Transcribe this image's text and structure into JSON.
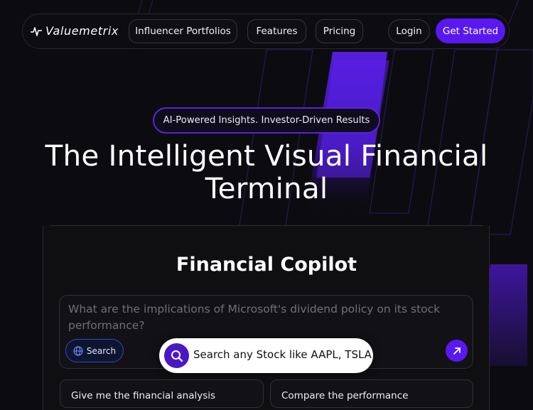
{
  "nav": {
    "brand": "Valuemetrix",
    "links": [
      "Influencer Portfolios",
      "Features",
      "Pricing"
    ],
    "login": "Login",
    "cta": "Get Started"
  },
  "hero": {
    "badge": "AI-Powered Insights. Investor-Driven Results",
    "title_line1": "The Intelligent Visual Financial",
    "title_line2": "Terminal"
  },
  "copilot": {
    "title": "Financial Copilot",
    "query_text": "What are the implications of Microsoft's dividend policy on its stock performance?",
    "search_label": "Search"
  },
  "stock_search": {
    "placeholder": "Search any Stock like AAPL, TSLA"
  },
  "suggestions": [
    "Give me the financial analysis",
    "Compare the performance"
  ],
  "colors": {
    "accent": "#5a18f0",
    "background": "#0c0c10",
    "badge_border": "#5a22e0"
  }
}
